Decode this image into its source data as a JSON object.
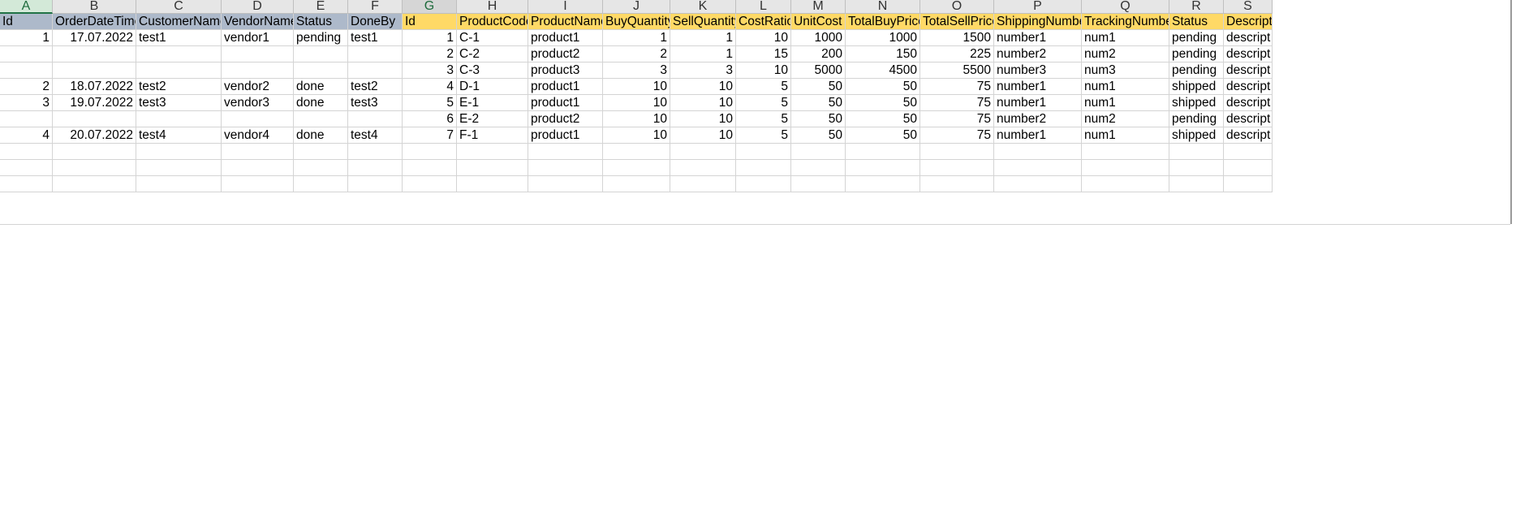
{
  "columns": [
    {
      "letter": "A",
      "header": "Id"
    },
    {
      "letter": "B",
      "header": "OrderDateTime"
    },
    {
      "letter": "C",
      "header": "CustomerName"
    },
    {
      "letter": "D",
      "header": "VendorName"
    },
    {
      "letter": "E",
      "header": "Status"
    },
    {
      "letter": "F",
      "header": "DoneBy"
    },
    {
      "letter": "G",
      "header": "Id"
    },
    {
      "letter": "H",
      "header": "ProductCode"
    },
    {
      "letter": "I",
      "header": "ProductName"
    },
    {
      "letter": "J",
      "header": "BuyQuantity"
    },
    {
      "letter": "K",
      "header": "SellQuantity"
    },
    {
      "letter": "L",
      "header": "CostRatio"
    },
    {
      "letter": "M",
      "header": "UnitCost"
    },
    {
      "letter": "N",
      "header": "TotalBuyPrice"
    },
    {
      "letter": "O",
      "header": "TotalSellPrice"
    },
    {
      "letter": "P",
      "header": "ShippingNumber"
    },
    {
      "letter": "Q",
      "header": "TrackingNumber"
    },
    {
      "letter": "R",
      "header": "Status"
    },
    {
      "letter": "S",
      "header": "Descript"
    }
  ],
  "rows": [
    [
      "1",
      "17.07.2022",
      "test1",
      "vendor1",
      "pending",
      "test1",
      "1",
      "C-1",
      "product1",
      "1",
      "1",
      "10",
      "1000",
      "1000",
      "1500",
      "number1",
      "num1",
      "pending",
      "descript"
    ],
    [
      "",
      "",
      "",
      "",
      "",
      "",
      "2",
      "C-2",
      "product2",
      "2",
      "1",
      "15",
      "200",
      "150",
      "225",
      "number2",
      "num2",
      "pending",
      "descript"
    ],
    [
      "",
      "",
      "",
      "",
      "",
      "",
      "3",
      "C-3",
      "product3",
      "3",
      "3",
      "10",
      "5000",
      "4500",
      "5500",
      "number3",
      "num3",
      "pending",
      "descript"
    ],
    [
      "2",
      "18.07.2022",
      "test2",
      "vendor2",
      "done",
      "test2",
      "4",
      "D-1",
      "product1",
      "10",
      "10",
      "5",
      "50",
      "50",
      "75",
      "number1",
      "num1",
      "shipped",
      "descript"
    ],
    [
      "3",
      "19.07.2022",
      "test3",
      "vendor3",
      "done",
      "test3",
      "5",
      "E-1",
      "product1",
      "10",
      "10",
      "5",
      "50",
      "50",
      "75",
      "number1",
      "num1",
      "shipped",
      "descript"
    ],
    [
      "",
      "",
      "",
      "",
      "",
      "",
      "6",
      "E-2",
      "product2",
      "10",
      "10",
      "5",
      "50",
      "50",
      "75",
      "number2",
      "num2",
      "pending",
      "descript"
    ],
    [
      "4",
      "20.07.2022",
      "test4",
      "vendor4",
      "done",
      "test4",
      "7",
      "F-1",
      "product1",
      "10",
      "10",
      "5",
      "50",
      "50",
      "75",
      "number1",
      "num1",
      "shipped",
      "descript"
    ],
    [
      "",
      "",
      "",
      "",
      "",
      "",
      "",
      "",
      "",
      "",
      "",
      "",
      "",
      "",
      "",
      "",
      "",
      "",
      ""
    ],
    [
      "",
      "",
      "",
      "",
      "",
      "",
      "",
      "",
      "",
      "",
      "",
      "",
      "",
      "",
      "",
      "",
      "",
      "",
      ""
    ],
    [
      "",
      "",
      "",
      "",
      "",
      "",
      "",
      "",
      "",
      "",
      "",
      "",
      "",
      "",
      "",
      "",
      "",
      "",
      ""
    ]
  ],
  "colors": {
    "header_group1": "#adb9ca",
    "header_group2": "#ffd966",
    "selection_accent": "#217346"
  }
}
